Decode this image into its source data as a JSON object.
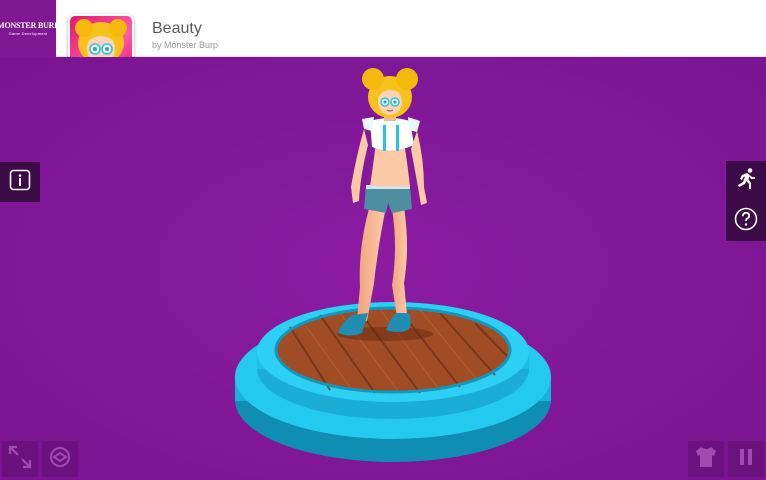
{
  "header": {
    "brand": {
      "name": "MONSTER BURP",
      "tagline": "Game Development"
    },
    "app_icon": "character-portrait-icon",
    "title": "Beauty",
    "author": "by Monster Burp"
  },
  "toolbar_left": {
    "info_icon": "info-icon"
  },
  "toolbar_right": {
    "animation_icon": "running-figure-icon",
    "help_icon": "help-question-icon"
  },
  "bottom_controls": {
    "fullscreen_icon": "fullscreen-expand-icon",
    "vr_icon": "vr-cardboard-icon",
    "outfit_icon": "shirt-icon",
    "pause_icon": "pause-icon"
  },
  "colors": {
    "background": "#7f1793",
    "panel": "#3c0b47",
    "platform": "#1fc3ea",
    "wood": "#a0522d",
    "app_icon_bg": "#e2156f"
  }
}
